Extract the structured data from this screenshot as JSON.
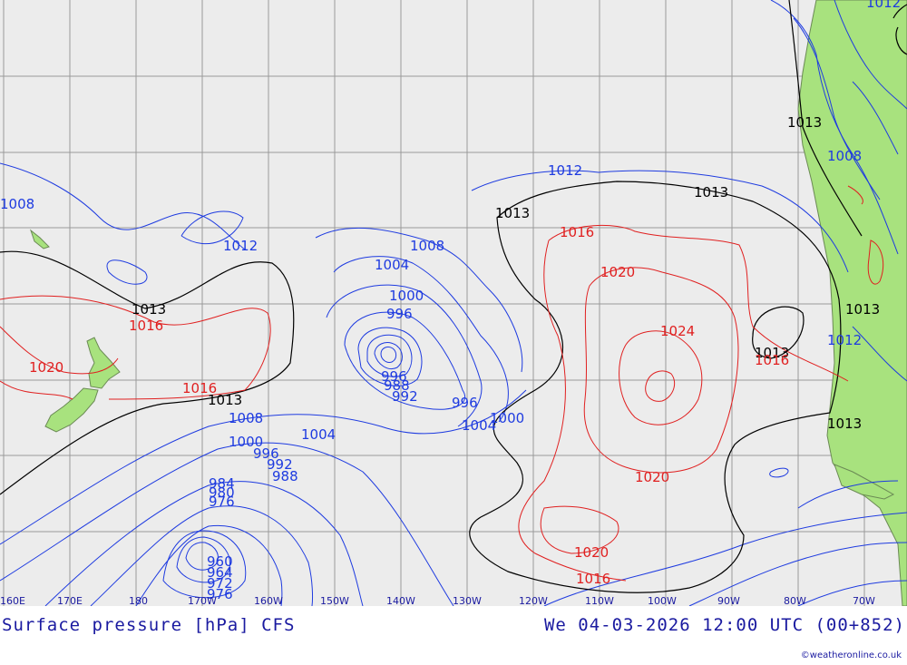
{
  "title": {
    "left": "Surface pressure [hPa] CFS",
    "right": "We 04-03-2026 12:00 UTC (00+852)"
  },
  "credit": "©weatheronline.co.uk",
  "longitude_labels": [
    "160E",
    "170E",
    "180",
    "170W",
    "160W",
    "150W",
    "140W",
    "130W",
    "120W",
    "110W",
    "100W",
    "90W",
    "80W",
    "70W"
  ],
  "isobar_labels": {
    "black": [
      "1013",
      "1013",
      "1013",
      "1013",
      "1013",
      "1013",
      "1013",
      "1013"
    ],
    "blue": [
      "1012",
      "1008",
      "1012",
      "1012",
      "1008",
      "1004",
      "1000",
      "996",
      "1008",
      "1004",
      "1000",
      "996",
      "992",
      "988",
      "984",
      "1004",
      "1000",
      "996",
      "1004",
      "1000",
      "996",
      "992",
      "988",
      "984",
      "980",
      "976",
      "972",
      "968",
      "964",
      "960",
      "976",
      "1008",
      "1012"
    ],
    "red": [
      "1016",
      "1020",
      "1016",
      "1016",
      "1020",
      "1024",
      "1020",
      "1020",
      "1016",
      "1016"
    ]
  },
  "colors": {
    "ocean": "#ececec",
    "land": "#a8e27e",
    "grid": "#9a9a9a",
    "isobar_low": "#1e3be0",
    "isobar_standard": "#000000",
    "isobar_high": "#e02020",
    "text": "#1a1aa0"
  }
}
